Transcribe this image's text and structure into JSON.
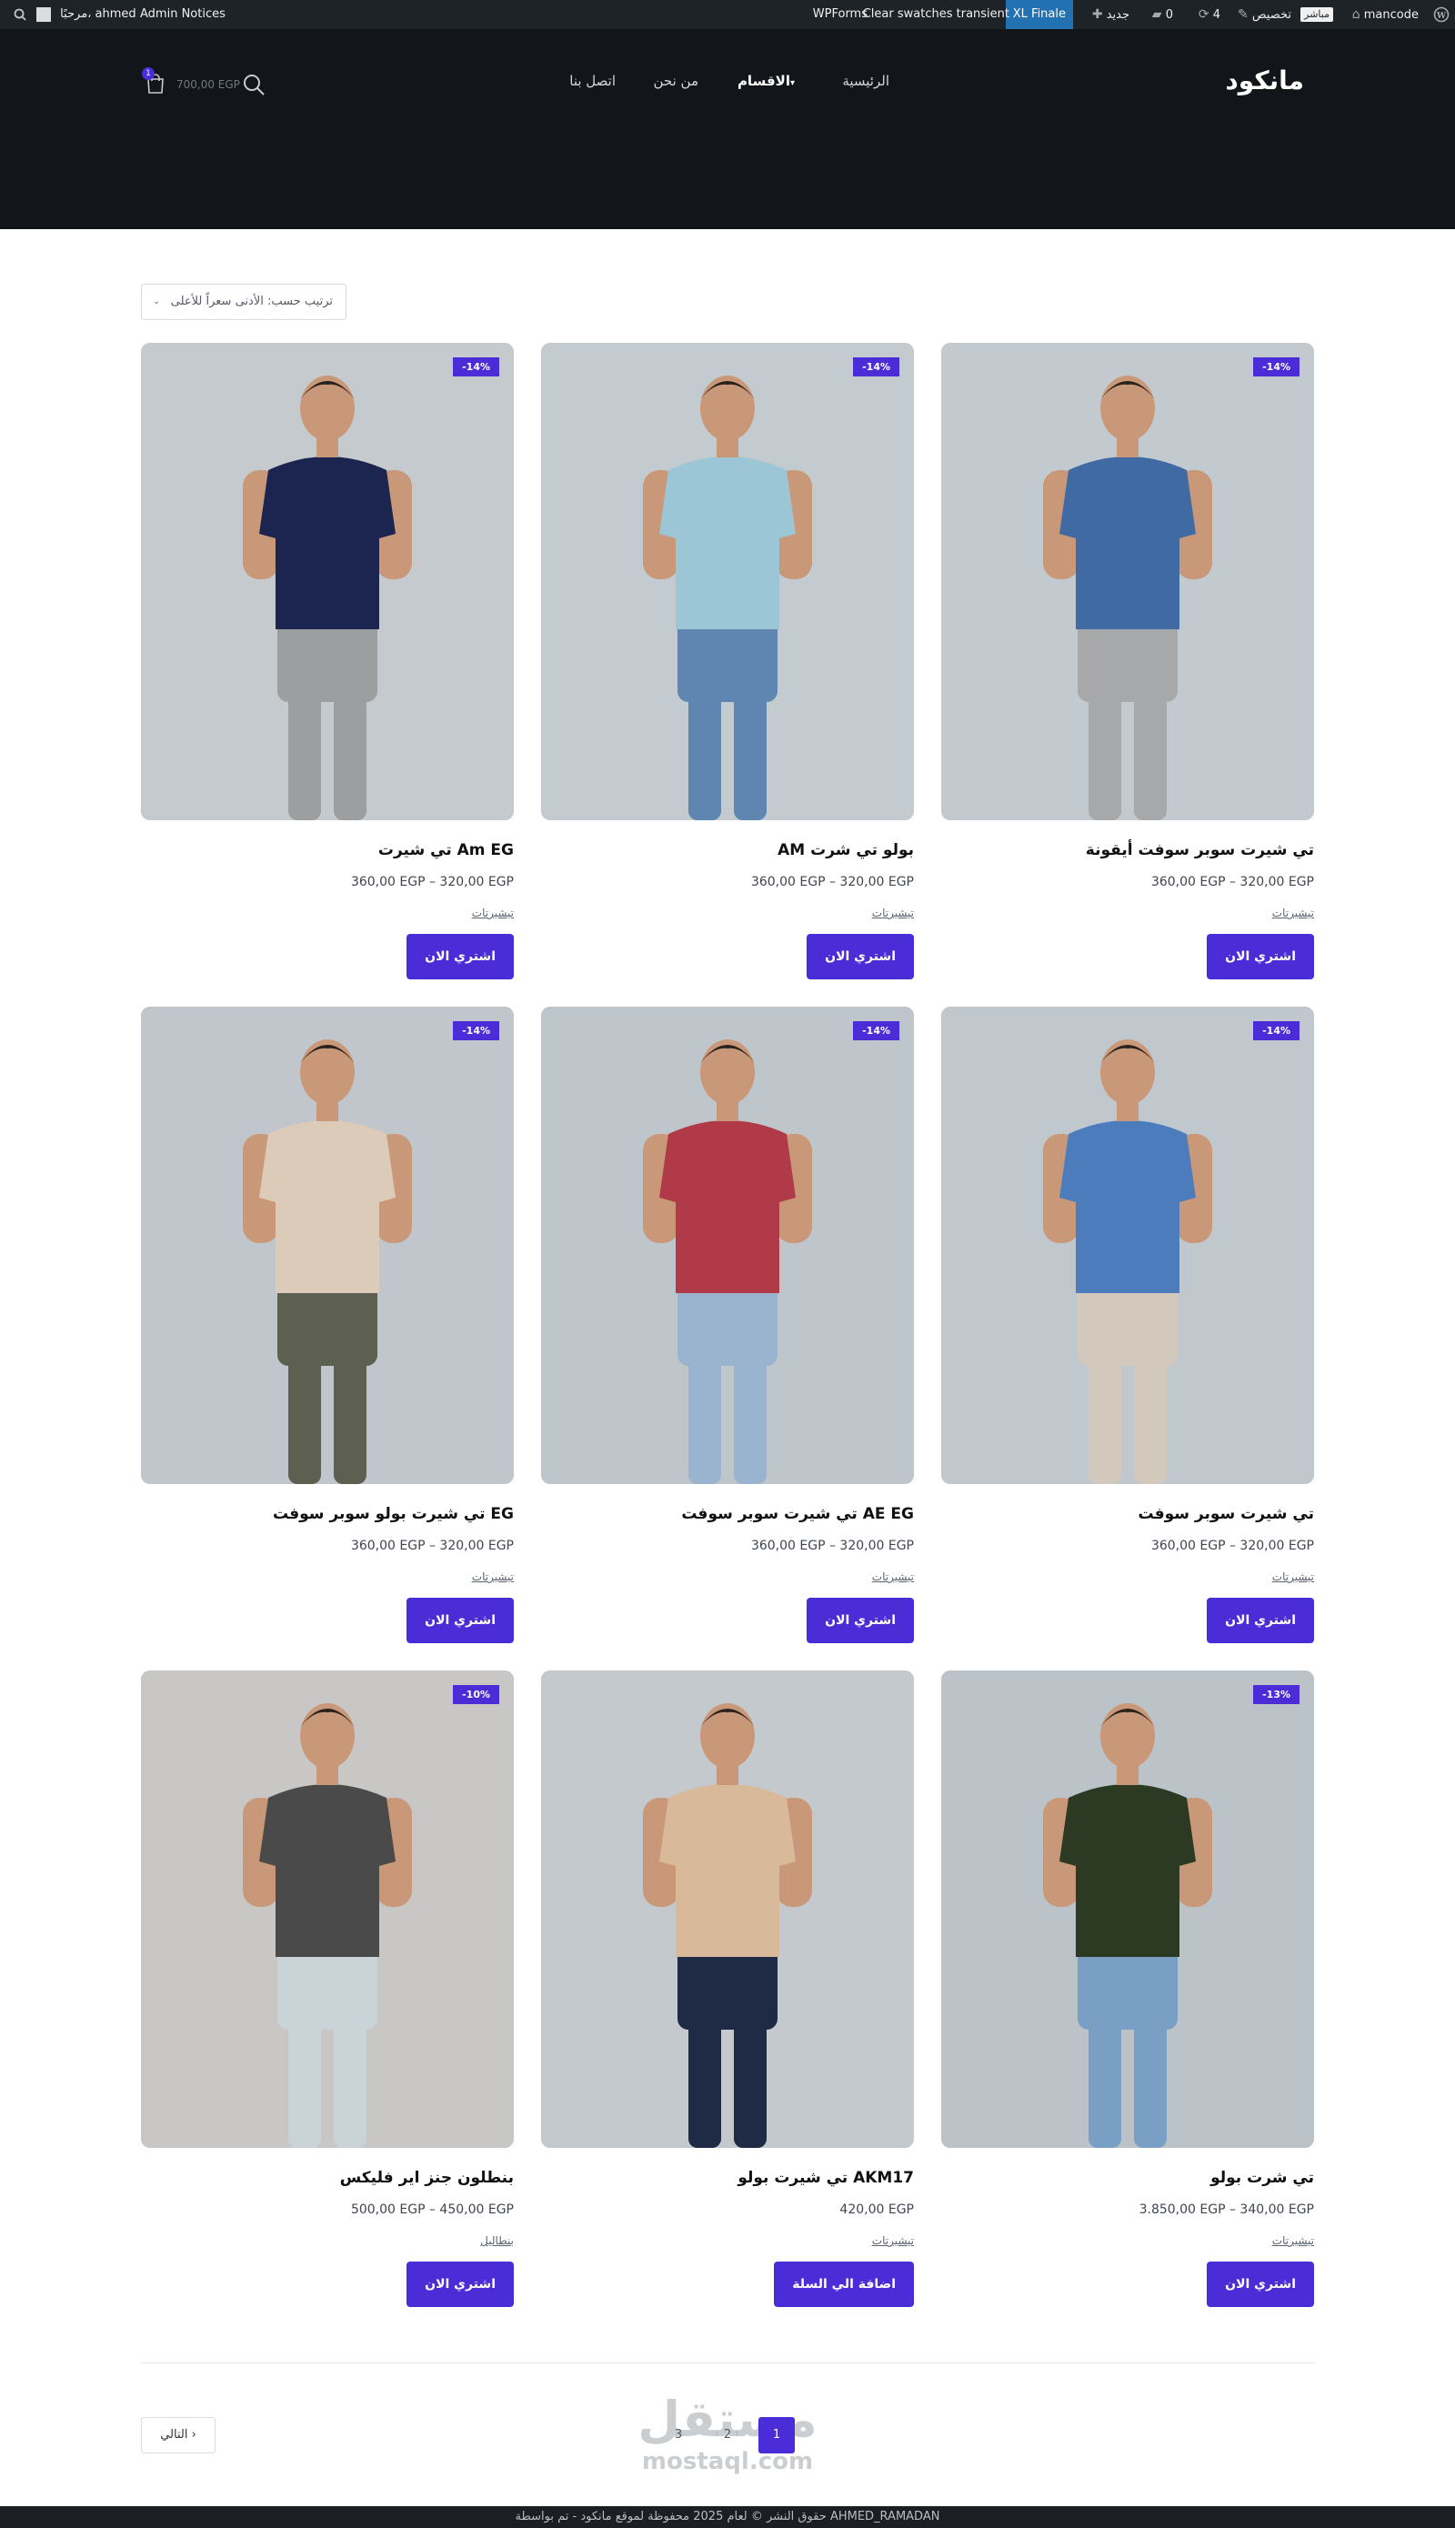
{
  "admin_bar": {
    "site_name": "mancode",
    "live_label": "مباشر",
    "customize_label": "تخصيص",
    "updates_count": "4",
    "comments_count": "0",
    "new_label": "جديد",
    "xl_finale_label": "XL Finale",
    "clear_swatches_label": "Clear swatches transient",
    "wpforms_label": "WPForms",
    "admin_notices_label": "Admin Notices",
    "greeting": "مرحبًا، ahmed"
  },
  "header": {
    "logo": "مانكود",
    "nav": [
      {
        "label": "الرئيسية"
      },
      {
        "label": "الاقسام"
      },
      {
        "label": "من نحن"
      },
      {
        "label": "اتصل بنا"
      }
    ],
    "cart_count": "1",
    "cart_total": "700,00 EGP"
  },
  "shop": {
    "sort_label": "ترتيب حسب: الأدنى سعراً للأعلى",
    "products": [
      {
        "title": "تي شيرت سوبر سوفت أيقونة",
        "price": "360,00 EGP – 320,00 EGP",
        "category": "تيشيرتات",
        "badge": "-14%",
        "button": "اشتري الان",
        "colors": {
          "bg": "#c3cacf",
          "shirt": "#3f6aa3",
          "pants": "#a6a8a9",
          "skin": "#c99878"
        }
      },
      {
        "title": "AM بولو تي شرت",
        "price": "360,00 EGP – 320,00 EGP",
        "category": "تيشيرتات",
        "badge": "-14%",
        "button": "اشتري الان",
        "colors": {
          "bg": "#c3cbd0",
          "shirt": "#9cc6d6",
          "pants": "#5f86b0",
          "skin": "#c99878"
        }
      },
      {
        "title": "تي شيرت Am EG",
        "price": "360,00 EGP – 320,00 EGP",
        "category": "تيشيرتات",
        "badge": "-14%",
        "button": "اشتري الان",
        "colors": {
          "bg": "#c4cacd",
          "shirt": "#1b2550",
          "pants": "#9c9e9f",
          "skin": "#c99878"
        }
      },
      {
        "title": "تي شيرت سوبر سوفت",
        "price": "360,00 EGP – 320,00 EGP",
        "category": "تيشيرتات",
        "badge": "-14%",
        "button": "اشتري الان",
        "colors": {
          "bg": "#c0c8cd",
          "shirt": "#4d7cbd",
          "pants": "#d2c8bb",
          "skin": "#c99878"
        }
      },
      {
        "title": "تي شيرت سوبر سوفت AE EG",
        "price": "360,00 EGP – 320,00 EGP",
        "category": "تيشيرتات",
        "badge": "-14%",
        "button": "اشتري الان",
        "colors": {
          "bg": "#bec6cc",
          "shirt": "#b03a48",
          "pants": "#9ab3cf",
          "skin": "#c99878"
        }
      },
      {
        "title": "تي شيرت بولو سوبر سوفت EG",
        "price": "360,00 EGP – 320,00 EGP",
        "category": "تيشيرتات",
        "badge": "-14%",
        "button": "اشتري الان",
        "colors": {
          "bg": "#c0c6cb",
          "shirt": "#dccbb8",
          "pants": "#5d6050",
          "skin": "#c99878"
        }
      },
      {
        "title": "تي شرت بولو",
        "price": "3.850,00 EGP – 340,00 EGP",
        "category": "تيشيرتات",
        "badge": "-13%",
        "button": "اشتري الان",
        "colors": {
          "bg": "#bcc3c8",
          "shirt": "#2c3a23",
          "pants": "#7a9fc4",
          "skin": "#c99878"
        }
      },
      {
        "title": "تي شيرت بولو AKM17",
        "price": "420,00 EGP",
        "category": "تيشيرتات",
        "badge": "",
        "button": "اضافة الي السلة",
        "colors": {
          "bg": "#c4c9cd",
          "shirt": "#d8b99a",
          "pants": "#1f2a44",
          "skin": "#c99878"
        }
      },
      {
        "title": "بنطلون جنز اير فليكس",
        "price": "500,00 EGP – 450,00 EGP",
        "category": "بنطاليل",
        "badge": "-10%",
        "button": "اشتري الان",
        "colors": {
          "bg": "#c9c6c6",
          "shirt": "#4a4a4a",
          "pants": "#c9d3d8",
          "skin": "#c99878"
        }
      }
    ]
  },
  "pagination": {
    "pages": [
      "1",
      "2",
      "3"
    ],
    "current": "1",
    "next_label": "التالي",
    "next_arrow": "›",
    "watermark_ar": "مستقل",
    "watermark_en": "mostaql.com"
  },
  "footer": {
    "text": "حقوق النشر © لعام 2025 محفوظة لموقع مانكود - تم بواسطة AHMED_RAMADAN"
  }
}
